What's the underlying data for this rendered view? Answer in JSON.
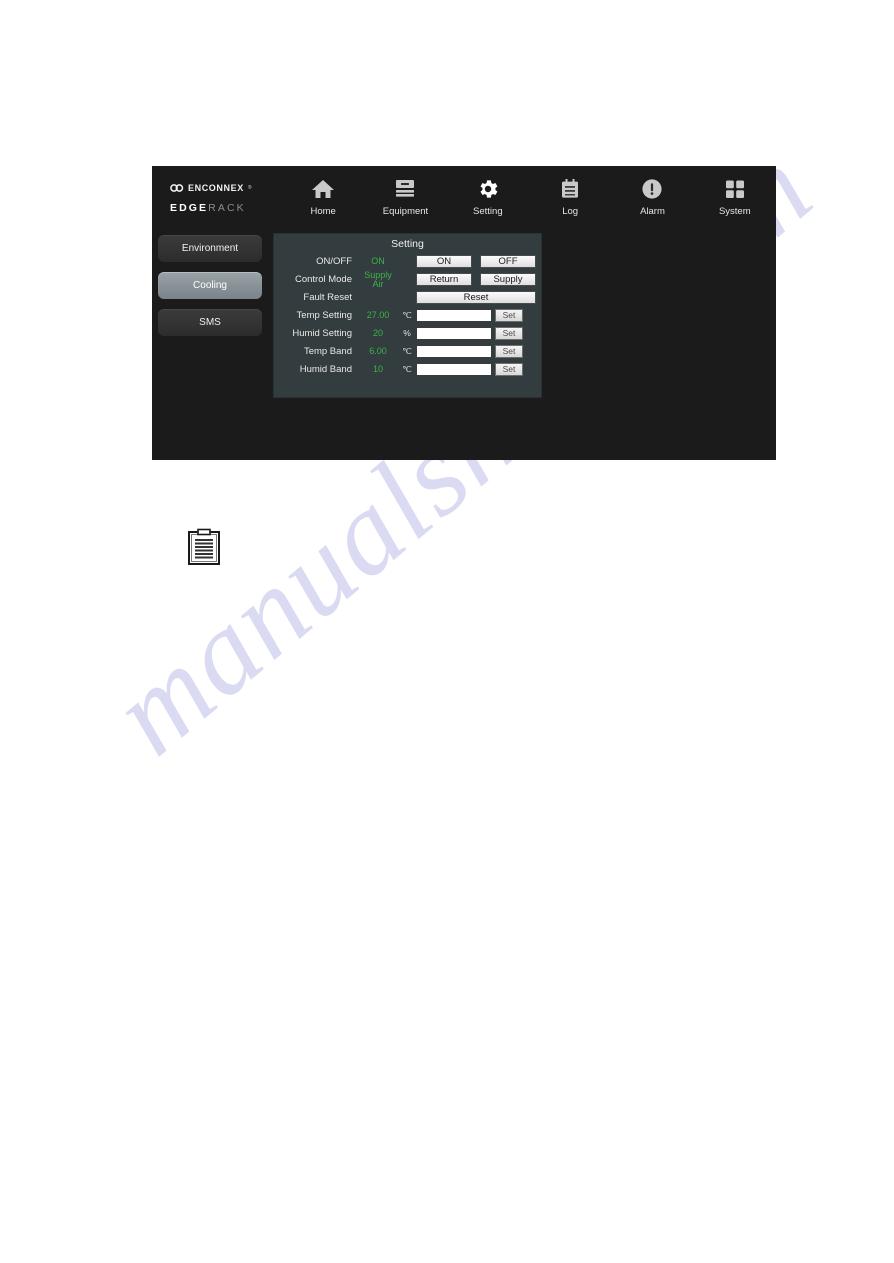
{
  "page": {
    "watermark": "manualshive.com"
  },
  "brand": {
    "mark_icon": "enconnex-double-circle-icon",
    "company": "ENCONNEX",
    "trademark": "®",
    "product_prefix": "EDGE",
    "product_suffix": "RACK"
  },
  "nav": {
    "items": [
      {
        "label": "Home",
        "icon": "home-icon"
      },
      {
        "label": "Equipment",
        "icon": "equipment-rack-icon"
      },
      {
        "label": "Setting",
        "icon": "gear-icon"
      },
      {
        "label": "Log",
        "icon": "clipboard-log-icon"
      },
      {
        "label": "Alarm",
        "icon": "alarm-exclamation-icon"
      },
      {
        "label": "System",
        "icon": "grid-squares-icon"
      }
    ],
    "active": "Setting"
  },
  "sidebar": {
    "items": [
      {
        "label": "Environment",
        "active": false
      },
      {
        "label": "Cooling",
        "active": true
      },
      {
        "label": "SMS",
        "active": false
      }
    ]
  },
  "panel": {
    "title": "Setting",
    "rows": [
      {
        "label": "ON/OFF",
        "value": "ON",
        "unit": "",
        "type": "dual-button",
        "buttons": [
          "ON",
          "OFF"
        ]
      },
      {
        "label": "Control Mode",
        "value": "Supply Air",
        "unit": "",
        "type": "dual-button",
        "buttons": [
          "Return",
          "Supply"
        ]
      },
      {
        "label": "Fault Reset",
        "value": "",
        "unit": "",
        "type": "wide-button",
        "buttons": [
          "Reset"
        ]
      },
      {
        "label": "Temp Setting",
        "value": "27.00",
        "unit": "℃",
        "type": "input",
        "input_value": "",
        "set_label": "Set"
      },
      {
        "label": "Humid Setting",
        "value": "20",
        "unit": "%",
        "type": "input",
        "input_value": "",
        "set_label": "Set"
      },
      {
        "label": "Temp Band",
        "value": "6.00",
        "unit": "℃",
        "type": "input",
        "input_value": "",
        "set_label": "Set"
      },
      {
        "label": "Humid Band",
        "value": "10",
        "unit": "℃",
        "type": "input",
        "input_value": "",
        "set_label": "Set"
      }
    ]
  },
  "figure": {
    "doc_icon": "document-clipboard-icon"
  },
  "colors": {
    "value_green": "#3cb34a",
    "panel_bg": "#333c3e",
    "ui_bg": "#1b1b1b",
    "watermark": "#d9d9f2"
  }
}
